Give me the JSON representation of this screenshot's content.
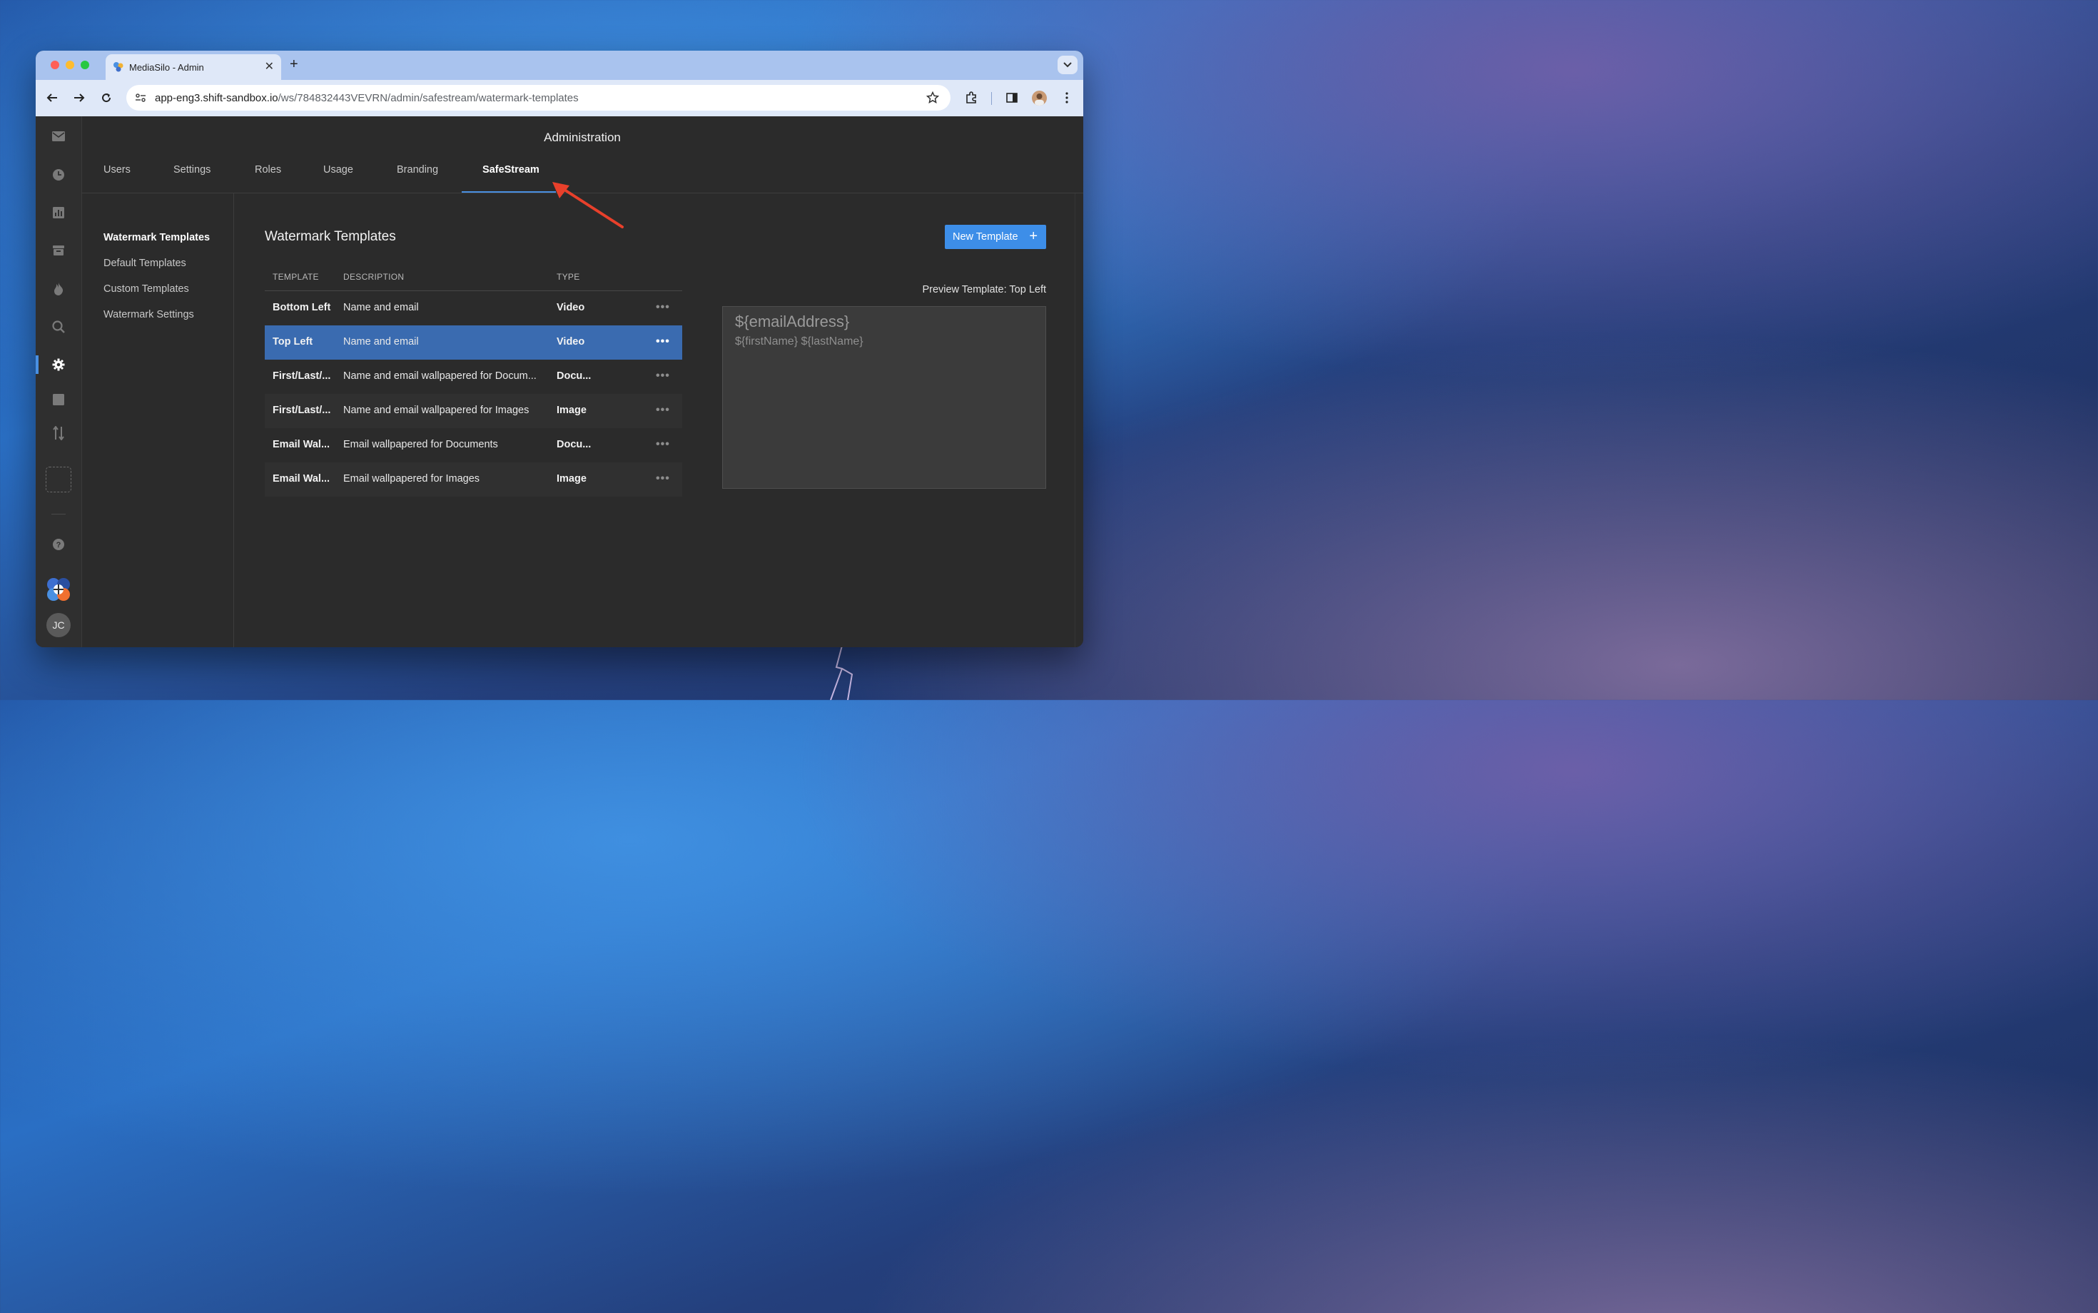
{
  "browser": {
    "tab_title": "MediaSilo - Admin",
    "url_host": "app-eng3.shift-sandbox.io",
    "url_path": "/ws/784832443VEVRN/admin/safestream/watermark-templates"
  },
  "app": {
    "title": "Administration",
    "tabs": [
      {
        "label": "Users"
      },
      {
        "label": "Settings"
      },
      {
        "label": "Roles"
      },
      {
        "label": "Usage"
      },
      {
        "label": "Branding"
      },
      {
        "label": "SafeStream"
      }
    ],
    "active_tab": "SafeStream",
    "subnav": [
      {
        "label": "Watermark Templates"
      },
      {
        "label": "Default Templates"
      },
      {
        "label": "Custom Templates"
      },
      {
        "label": "Watermark Settings"
      }
    ],
    "user_initials": "JC",
    "rail_icons": [
      "mail-icon",
      "clock-icon",
      "chart-icon",
      "inbox-icon",
      "fire-icon",
      "search-icon",
      "gear-icon",
      "square-icon",
      "sort-icon",
      "help-icon",
      "logo-icon"
    ]
  },
  "content": {
    "title": "Watermark Templates",
    "new_button": "New Template",
    "table": {
      "headers": {
        "template": "TEMPLATE",
        "description": "DESCRIPTION",
        "type": "TYPE"
      },
      "rows": [
        {
          "template": "Bottom Left",
          "description": "Name and email",
          "type": "Video"
        },
        {
          "template": "Top Left",
          "description": "Name and email",
          "type": "Video",
          "selected": true
        },
        {
          "template": "First/Last/...",
          "description": "Name and email wallpapered for Docum...",
          "type": "Docu..."
        },
        {
          "template": "First/Last/...",
          "description": "Name and email wallpapered for Images",
          "type": "Image"
        },
        {
          "template": "Email Wal...",
          "description": "Email wallpapered for Documents",
          "type": "Docu..."
        },
        {
          "template": "Email Wal...",
          "description": "Email wallpapered for Images",
          "type": "Image"
        }
      ],
      "row_menu": "•••"
    },
    "preview": {
      "label": "Preview Template: Top Left",
      "line1": "${emailAddress}",
      "line2": "${firstName} ${lastName}"
    }
  },
  "colors": {
    "accent": "#3d8ee8",
    "selected_row": "#3a6bb0",
    "annotation_arrow": "#e8402b"
  }
}
